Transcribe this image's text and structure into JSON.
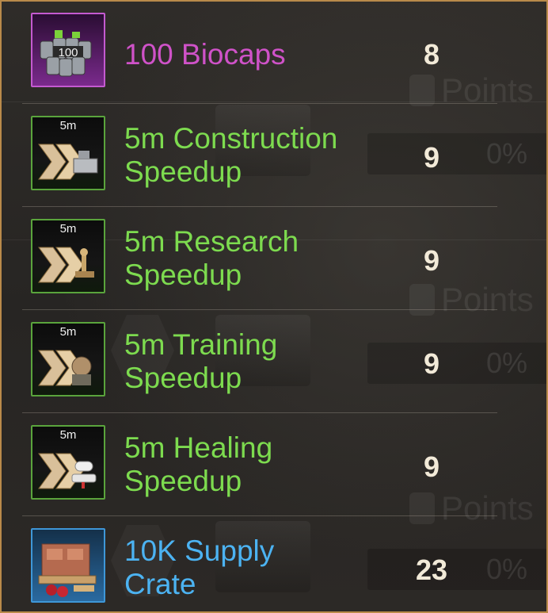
{
  "background": {
    "points_label": "Points",
    "percent_label": "0%"
  },
  "colors": {
    "frame_border": "#b98a4a",
    "rarity_purple": "#cf52c8",
    "rarity_green": "#7ddb4f",
    "rarity_blue": "#4cb3f2",
    "quantity_text": "#f2ead8"
  },
  "rewards": [
    {
      "name": "100 Biocaps",
      "quantity": "8",
      "icon": "biocaps-icon",
      "icon_label": "100",
      "rarity": "purple"
    },
    {
      "name": "5m Construction\nSpeedup",
      "quantity": "9",
      "icon": "construction-speedup-icon",
      "icon_label": "5m",
      "rarity": "green"
    },
    {
      "name": "5m Research\nSpeedup",
      "quantity": "9",
      "icon": "research-speedup-icon",
      "icon_label": "5m",
      "rarity": "green"
    },
    {
      "name": "5m Training\nSpeedup",
      "quantity": "9",
      "icon": "training-speedup-icon",
      "icon_label": "5m",
      "rarity": "green"
    },
    {
      "name": "5m Healing\nSpeedup",
      "quantity": "9",
      "icon": "healing-speedup-icon",
      "icon_label": "5m",
      "rarity": "green"
    },
    {
      "name": "10K Supply\nCrate",
      "quantity": "23",
      "icon": "supply-crate-icon",
      "icon_label": "",
      "rarity": "blue"
    }
  ]
}
